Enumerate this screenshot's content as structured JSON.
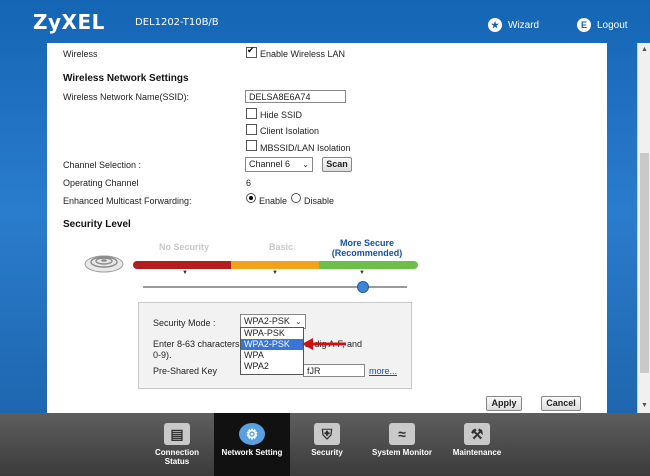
{
  "header": {
    "brand": "ZyXEL",
    "model": "DEL1202-T10B/B",
    "wizard_label": "Wizard",
    "logout_label": "Logout"
  },
  "wireless": {
    "label": "Wireless",
    "enable_label": "Enable Wireless LAN",
    "enabled": true
  },
  "network_settings": {
    "title": "Wireless Network Settings",
    "ssid_label": "Wireless Network Name(SSID):",
    "ssid_value": "DELSA8E6A74",
    "hide_ssid_label": "Hide SSID",
    "client_isolation_label": "Client Isolation",
    "mbssid_label": "MBSSID/LAN Isolation",
    "channel_label": "Channel Selection :",
    "channel_value": "Channel 6",
    "scan_label": "Scan",
    "operating_channel_label": "Operating Channel",
    "operating_channel_value": "6",
    "multicast_label": "Enhanced Multicast Forwarding:",
    "enable_label": "Enable",
    "disable_label": "Disable"
  },
  "security": {
    "title": "Security Level",
    "no_security": "No Security",
    "basic": "Basic",
    "more_secure": "More Secure",
    "recommended": "(Recommended)",
    "mode_label": "Security Mode :",
    "mode_value": "WPA2-PSK",
    "hint_left": "Enter 8-63 characters",
    "hint_right": "al dig   A-F, and",
    "hint_line2": "0-9).",
    "psk_label": "Pre-Shared Key",
    "psk_value": "fJR",
    "more_link": "more...",
    "options": [
      "WPA-PSK",
      "WPA2-PSK",
      "WPA",
      "WPA2"
    ],
    "selected_option": "WPA2-PSK"
  },
  "actions": {
    "apply_label": "Apply",
    "cancel_label": "Cancel"
  },
  "nav": [
    {
      "label1": "Connection",
      "label2": "Status"
    },
    {
      "label1": "Network Setting",
      "label2": ""
    },
    {
      "label1": "Security",
      "label2": ""
    },
    {
      "label1": "System Monitor",
      "label2": ""
    },
    {
      "label1": "Maintenance",
      "label2": ""
    }
  ],
  "colors": {
    "bar_red": "#b51d1d",
    "bar_orange": "#f2a21a",
    "bar_green": "#6cc04a",
    "link_blue": "#1a4fa0"
  }
}
